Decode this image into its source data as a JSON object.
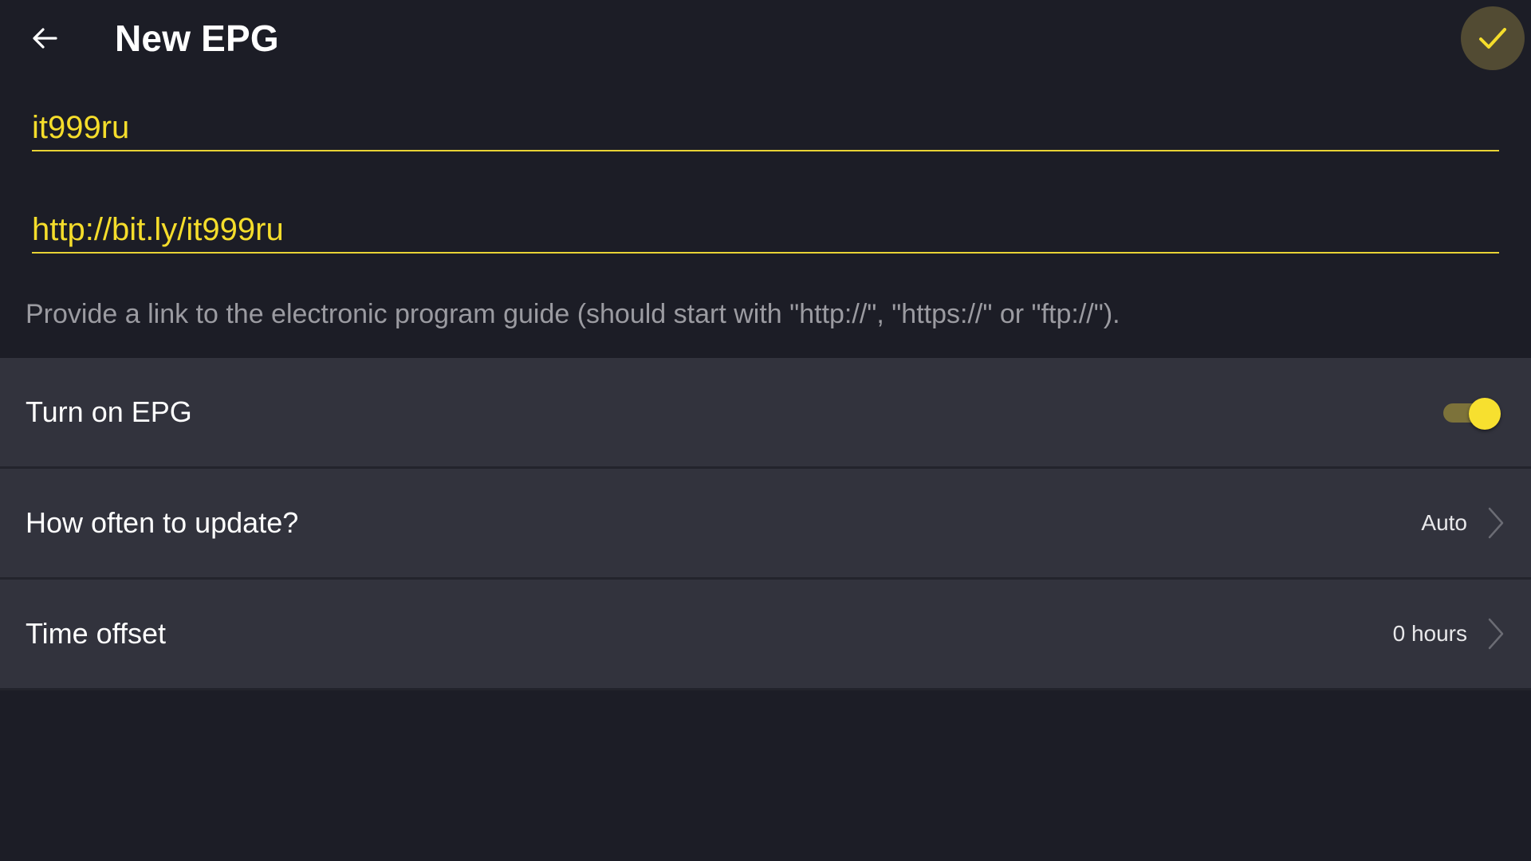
{
  "header": {
    "title": "New EPG",
    "back_icon": "arrow-left-icon",
    "confirm_icon": "check-icon"
  },
  "form": {
    "name_value": "it999ru",
    "url_value": "http://bit.ly/it999ru",
    "hint": "Provide a link to the electronic program guide (should start with \"http://\", \"https://\" or \"ftp://\")."
  },
  "settings": {
    "enable": {
      "label": "Turn on EPG",
      "enabled": true
    },
    "update": {
      "label": "How often to update?",
      "value": "Auto"
    },
    "offset": {
      "label": "Time offset",
      "value": "0 hours"
    }
  },
  "colors": {
    "background": "#1c1d26",
    "row_background": "#32333d",
    "accent": "#f5dd2b",
    "hint_text": "#9b9ba1"
  }
}
